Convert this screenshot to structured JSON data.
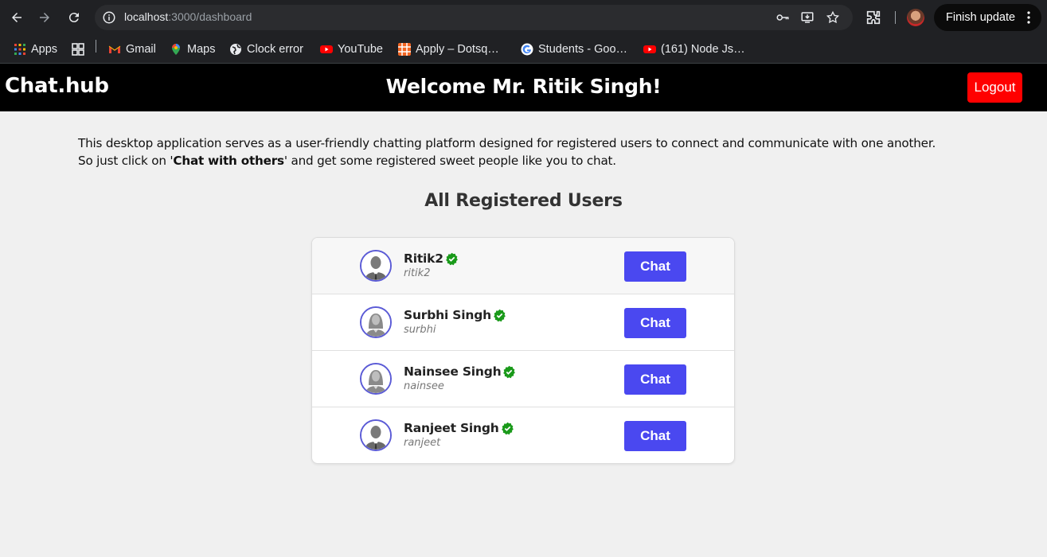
{
  "browser": {
    "url_host": "localhost",
    "url_path": ":3000/dashboard",
    "finish_update_label": "Finish update",
    "bookmarks": [
      {
        "label": "Apps",
        "icon": "apps-grid-icon"
      },
      {
        "label": "Gmail",
        "icon": "gmail-icon"
      },
      {
        "label": "Maps",
        "icon": "maps-icon"
      },
      {
        "label": "Clock error",
        "icon": "globe-icon"
      },
      {
        "label": "YouTube",
        "icon": "youtube-icon"
      },
      {
        "label": "Apply – Dotsq…",
        "icon": "dotsquares-icon"
      },
      {
        "label": "Students - Goo…",
        "icon": "google-icon"
      },
      {
        "label": "(161) Node Js…",
        "icon": "youtube-icon"
      }
    ]
  },
  "header": {
    "brand": "Chat.hub",
    "welcome": "Welcome Mr. Ritik Singh!",
    "logout_label": "Logout"
  },
  "intro": {
    "line1": "This desktop application serves as a user-friendly chatting platform designed for registered users to connect and communicate with one another.",
    "line2_before": "So just click on '",
    "line2_bold": "Chat with others",
    "line2_after": "' and get some registered sweet people like you to chat."
  },
  "section_title": "All Registered Users",
  "users": [
    {
      "name": "Ritik2",
      "username": "ritik2",
      "avatar": "male",
      "chat_label": "Chat"
    },
    {
      "name": "Surbhi Singh",
      "username": "surbhi",
      "avatar": "female",
      "chat_label": "Chat"
    },
    {
      "name": "Nainsee Singh",
      "username": "nainsee",
      "avatar": "female",
      "chat_label": "Chat"
    },
    {
      "name": "Ranjeet Singh",
      "username": "ranjeet",
      "avatar": "male",
      "chat_label": "Chat"
    }
  ],
  "colors": {
    "header_bg": "#000000",
    "logout_bg": "#ff0000",
    "chat_button_bg": "#4a48f0",
    "verified_green": "#1a9a1a",
    "page_bg": "#f0f0f0"
  }
}
